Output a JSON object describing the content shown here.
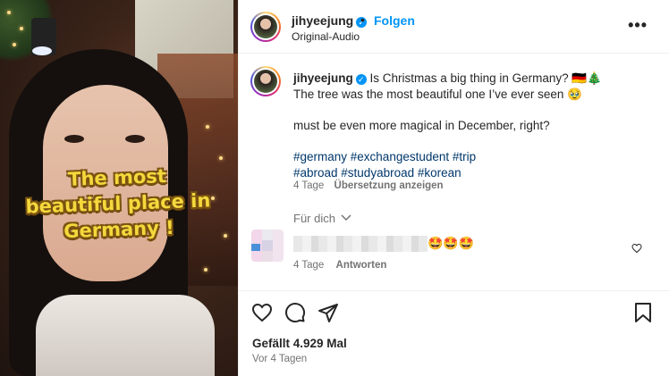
{
  "media": {
    "overlay_text": "The most beautiful place in Germany !"
  },
  "header": {
    "username": "jihyeejung",
    "separator": "•",
    "follow_label": "Folgen",
    "audio_label": "Original-Audio",
    "more_icon": "ellipsis-icon"
  },
  "caption": {
    "username": "jihyeejung",
    "line1": "Is Christmas a big thing in Germany? 🇩🇪🎄",
    "line2": "The tree was the most beautiful one I’ve ever seen 🥹",
    "line3": "must be even more magical in December, right?",
    "hashtags_line1": "#germany #exchangestudent #trip",
    "hashtags_line2": "#abroad #studyabroad #korean",
    "time": "4 Tage",
    "translate_label": "Übersetzung anzeigen"
  },
  "for_you_label": "Für dich",
  "comment": {
    "emoji": "🤩🤩🤩",
    "time": "4 Tage",
    "reply_label": "Antworten"
  },
  "actions": {
    "likes": "Gefällt 4.929 Mal",
    "date": "Vor 4 Tagen"
  },
  "colors": {
    "accent": "#0095f6",
    "hashtag": "#00376b",
    "secondary_text": "#737373",
    "overlay_text": "#f5d83c"
  }
}
